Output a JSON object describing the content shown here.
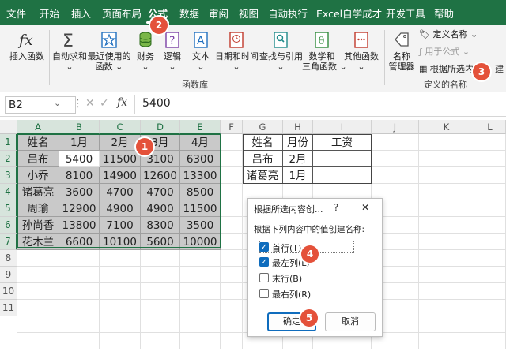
{
  "menu": {
    "tabs": [
      "文件",
      "开始",
      "插入",
      "页面布局",
      "公式",
      "数据",
      "审阅",
      "视图",
      "自动执行",
      "Excel自学成才",
      "开发工具",
      "帮助"
    ],
    "active": "公式"
  },
  "ribbon": {
    "insert_function": "插入函数",
    "autosum": "自动求和",
    "recent_line1": "最近使用的",
    "recent_line2": "函数",
    "finance": "财务",
    "logic": "逻辑",
    "text": "文本",
    "datetime": "日期和时间",
    "lookup": "查找与引用",
    "math_line1": "数学和",
    "math_line2": "三角函数",
    "more": "其他函数",
    "library_label": "函数库",
    "name_mgr_line1": "名称",
    "name_mgr_line2": "管理器",
    "define_name": "定义名称",
    "use_in_formula": "用于公式",
    "create_from_sel": "根据所选内",
    "create_tail": "建",
    "defined_names_label": "定义的名称"
  },
  "formula_bar": {
    "name_box": "B2",
    "fx": "fx",
    "value": "5400"
  },
  "sheet": {
    "columns": [
      "A",
      "B",
      "C",
      "D",
      "E",
      "F",
      "G",
      "H",
      "I",
      "J",
      "K",
      "L"
    ],
    "rows": [
      "1",
      "2",
      "3",
      "4",
      "5",
      "6",
      "7",
      "8",
      "9",
      "10",
      "11"
    ],
    "main_table": [
      [
        "姓名",
        "1月",
        "2月",
        "3月",
        "4月"
      ],
      [
        "吕布",
        "5400",
        "11500",
        "3100",
        "6300"
      ],
      [
        "小乔",
        "8100",
        "14900",
        "12600",
        "13300"
      ],
      [
        "诸葛亮",
        "3600",
        "4700",
        "4700",
        "8500"
      ],
      [
        "周瑜",
        "12900",
        "4900",
        "4900",
        "11500"
      ],
      [
        "孙尚香",
        "13800",
        "7100",
        "8300",
        "3500"
      ],
      [
        "花木兰",
        "6600",
        "10100",
        "5600",
        "10000"
      ]
    ],
    "lookup_table": [
      [
        "姓名",
        "月份",
        "工资"
      ],
      [
        "吕布",
        "2月",
        ""
      ],
      [
        "诸葛亮",
        "1月",
        ""
      ]
    ]
  },
  "dialog": {
    "title": "根据所选内容创...",
    "help": "?",
    "close": "✕",
    "prompt": "根据下列内容中的值创建名称:",
    "options": [
      {
        "label": "首行(T)",
        "checked": true
      },
      {
        "label": "最左列(L)",
        "checked": true
      },
      {
        "label": "末行(B)",
        "checked": false
      },
      {
        "label": "最右列(R)",
        "checked": false
      }
    ],
    "ok": "确定",
    "cancel": "取消"
  },
  "badges": [
    "1",
    "2",
    "3",
    "4",
    "5"
  ],
  "colors": {
    "excel_green": "#1f7244",
    "badge_red": "#e4513a",
    "selection_grey": "#c9c9c9",
    "check_blue": "#0f6cbd"
  }
}
